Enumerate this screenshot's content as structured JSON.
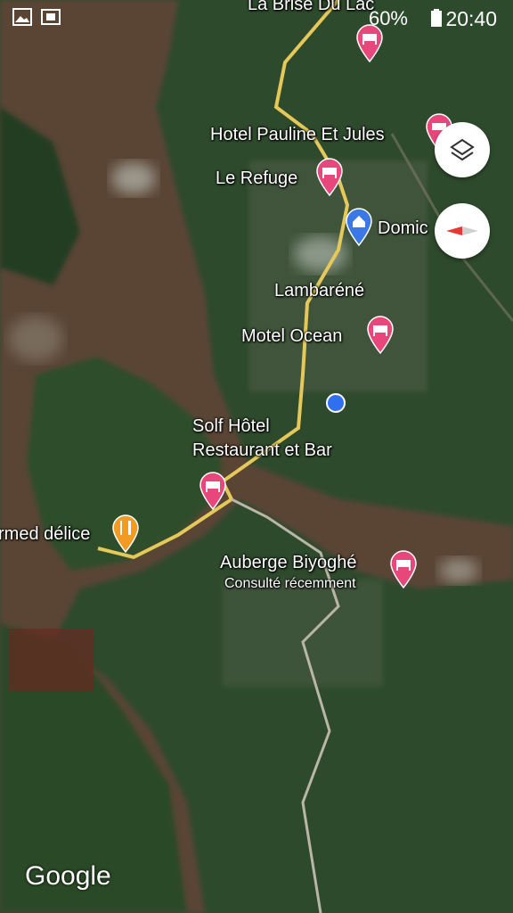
{
  "status_bar": {
    "battery": "60%",
    "time": "20:40"
  },
  "map": {
    "places": [
      {
        "name": "La Brise Du Lac",
        "kind": "hotel"
      },
      {
        "name": "Hotel Pauline Et Jules",
        "kind": "hotel"
      },
      {
        "name": "Le Refuge",
        "kind": "hotel"
      },
      {
        "name": "Domic",
        "kind": "home"
      },
      {
        "name": "Lambaréné",
        "kind": "city"
      },
      {
        "name": "Motel Ocean",
        "kind": "hotel"
      },
      {
        "name": "Solf Hôtel",
        "name2": "Restaurant et Bar",
        "kind": "hotel"
      },
      {
        "name": "rmed délice",
        "kind": "restaurant"
      },
      {
        "name": "Auberge Biyoghé",
        "sub": "Consulté récemment",
        "kind": "hotel"
      }
    ],
    "colors": {
      "hotel_pin": "#e8477c",
      "restaurant_pin": "#f29b24",
      "home_pin": "#3b78e7",
      "road": "#e5c85a",
      "location_dot": "#2f6ff0"
    },
    "attribution": "Google"
  },
  "controls": {
    "layers_icon": "layers-icon",
    "compass_icon": "compass-icon"
  }
}
